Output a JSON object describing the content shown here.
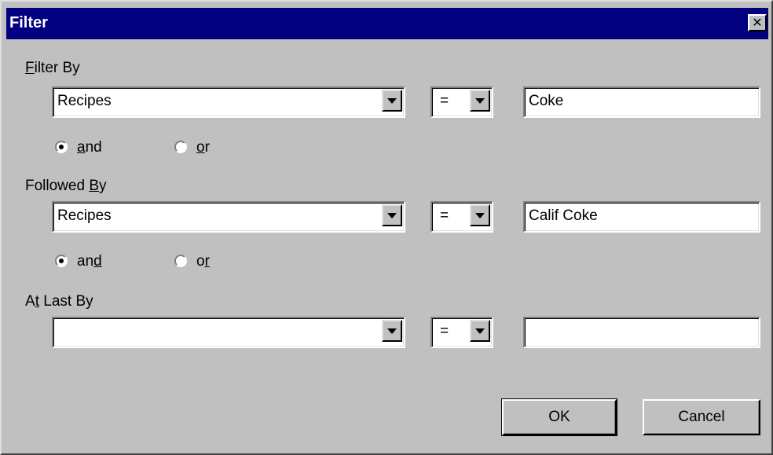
{
  "window": {
    "title": "Filter",
    "close_label": "✕"
  },
  "filter_by": {
    "label_pre": "",
    "label_mnemonic": "F",
    "label_post": "ilter By",
    "field_value": "Recipes",
    "operator_value": "=",
    "text_value": "Coke"
  },
  "connector_1": {
    "and_pre": "",
    "and_mnemonic": "a",
    "and_post": "nd",
    "or_pre": "",
    "or_mnemonic": "o",
    "or_post": "r",
    "selected": "and"
  },
  "followed_by": {
    "label_pre": "Followed ",
    "label_mnemonic": "B",
    "label_post": "y",
    "field_value": "Recipes",
    "operator_value": "=",
    "text_value": "Calif Coke"
  },
  "connector_2": {
    "and_pre": "an",
    "and_mnemonic": "d",
    "and_post": "",
    "or_pre": "o",
    "or_mnemonic": "r",
    "or_post": "",
    "selected": "and"
  },
  "at_last_by": {
    "label_pre": "A",
    "label_mnemonic": "t",
    "label_post": " Last By",
    "field_value": "",
    "operator_value": "=",
    "text_value": ""
  },
  "buttons": {
    "ok_label": "OK",
    "cancel_label": "Cancel"
  }
}
